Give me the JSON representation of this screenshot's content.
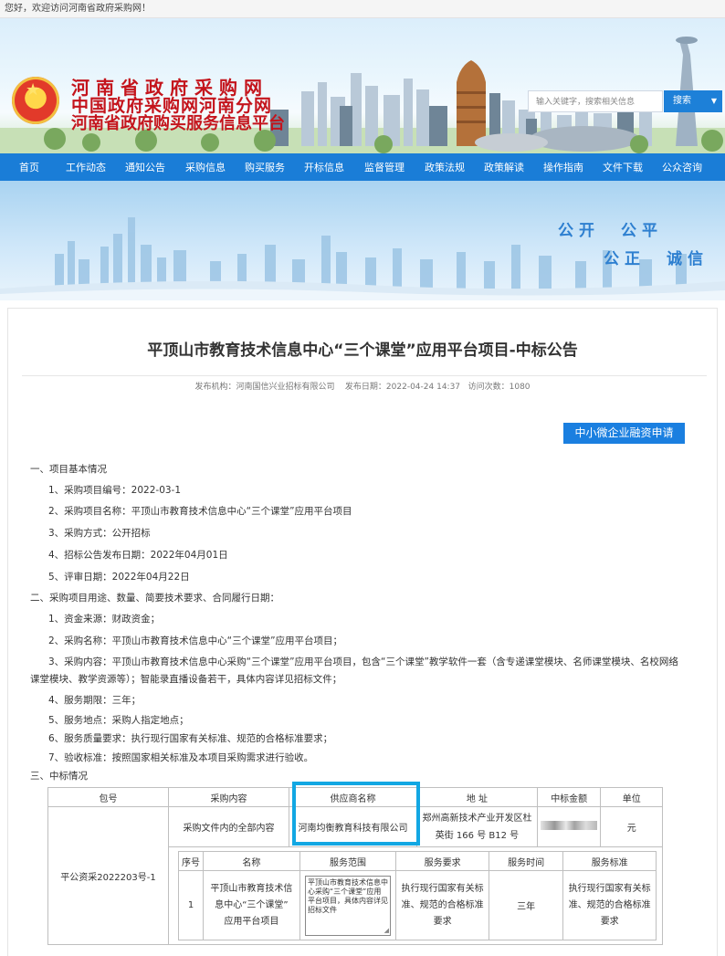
{
  "topbar": {
    "welcome": "您好，欢迎访问河南省政府采购网！"
  },
  "header": {
    "brand_line1": "河南省政府采购网",
    "brand_line2": "中国政府采购网河南分网",
    "brand_line3": "河南省政府购买服务信息平台",
    "search_placeholder": "输入关键字，搜索相关信息",
    "search_button": "搜索"
  },
  "nav": {
    "items": [
      "首页",
      "工作动态",
      "通知公告",
      "采购信息",
      "购买服务",
      "开标信息",
      "监督管理",
      "政策法规",
      "政策解读",
      "操作指南",
      "文件下载",
      "公众咨询"
    ]
  },
  "hero": {
    "slogan_line1": "公开　公平",
    "slogan_line2": "公正　诚信"
  },
  "article": {
    "title": "平顶山市教育技术信息中心“三个课堂”应用平台项目-中标公告",
    "meta_publisher": "发布机构：河南国信兴业招标有限公司",
    "meta_date": "发布日期：2022-04-24 14:37",
    "meta_visits": "访问次数：1080",
    "finance_button": "中小微企业融资申请",
    "sec1": "一、项目基本情况",
    "s1_1": "1、采购项目编号：2022-03-1",
    "s1_2": "2、采购项目名称：平顶山市教育技术信息中心“三个课堂”应用平台项目",
    "s1_3": "3、采购方式：公开招标",
    "s1_4": "4、招标公告发布日期：2022年04月01日",
    "s1_5": "5、评审日期：2022年04月22日",
    "sec2": "二、采购项目用途、数量、简要技术要求、合同履行日期：",
    "s2_1": "1、资金来源：财政资金；",
    "s2_2": "2、采购名称：平顶山市教育技术信息中心“三个课堂”应用平台项目；",
    "s2_3a": "3、采购内容：平顶山市教育技术信息中心采购“三个课堂”应用平台项目，包含“三个课堂”教学软件一套（含专递课堂模块、名师课堂模块、名校网络",
    "s2_3b": "课堂模块、教学资源等）；智能录直播设备若干，具体内容详见招标文件；",
    "s2_4": "4、服务期限：三年；",
    "s2_5": "5、服务地点：采购人指定地点；",
    "s2_6": "6、服务质量要求：执行现行国家有关标准、规范的合格标准要求；",
    "s2_7": "7、验收标准：按照国家相关标准及本项目采购需求进行验收。",
    "sec3": "三、中标情况"
  },
  "award_table": {
    "headers": [
      "包号",
      "采购内容",
      "供应商名称",
      "地 址",
      "中标金额",
      "单位"
    ],
    "package": "平公资采2022203号-1",
    "content": "采购文件内的全部内容",
    "supplier": "河南均衡教育科技有限公司",
    "address_line1": "郑州高新技术产业开发区杜",
    "address_line2": "英街 166 号 B12 号",
    "unit": "元",
    "sub_headers": [
      "序号",
      "名称",
      "服务范围",
      "服务要求",
      "服务时间",
      "服务标准"
    ],
    "sub_row": {
      "no": "1",
      "name_l1": "平顶山市教育技术信",
      "name_l2": "息中心“三个课堂”",
      "name_l3": "应用平台项目",
      "scope": "平顶山市教育技术信息中心采购“三个课堂”应用平台项目，具体内容详见招标文件",
      "req_l1": "执行现行国家有关标",
      "req_l2": "准、规范的合格标准",
      "req_l3": "要求",
      "time": "三年",
      "std_l1": "执行现行国家有关标",
      "std_l2": "准、规范的合格标准",
      "std_l3": "要求"
    }
  }
}
